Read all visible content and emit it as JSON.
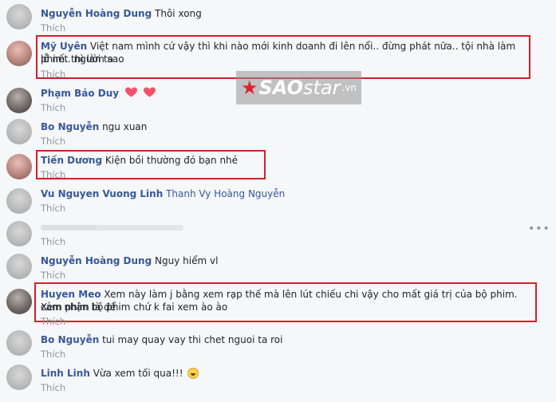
{
  "comments": [
    {
      "name": "Nguyễn Hoàng Dung",
      "text": "Thôi xong",
      "like": "Thích"
    },
    {
      "name": "Mỹ Uyên",
      "text": "Việt nam mình cứ vậy thì khi nào mới kinh doanh đi lên nổi.. đừng phát nữa.. tội nhà làm phim.. người ta",
      "text2": "lỗ nết thì làm sao",
      "like": "Thích"
    },
    {
      "name": "Phạm Bảo Duy",
      "text": "",
      "like": "Thích"
    },
    {
      "name": "Bo Nguyễn",
      "text": "ngu xuan",
      "like": "Thích"
    },
    {
      "name": "Tiến Dương",
      "text": "Kiện bồi thường đó bạn nhé",
      "like": "Thích"
    },
    {
      "name": "Vu Nguyen Vuong Linh",
      "text": "Thanh Vy Hoàng Nguyễn",
      "like": "Thích"
    },
    {
      "name": "",
      "text": "",
      "like": "Thích"
    },
    {
      "name": "Nguyễn Hoàng Dung",
      "text": "Nguy hiểm vl",
      "like": "Thích"
    },
    {
      "name": "Huyen Meo",
      "text": "Xem này làm j bằng xem rạp thế mà lên lút chiếu chi vậy cho mất giá trị của bộ phim. Xem phim là để",
      "text2": "cảm nhận bộ phim chứ k fai xem ào ào",
      "like": "Thích"
    },
    {
      "name": "Bo Nguyễn",
      "text": "tui may quay vay thi chet nguoi ta roi",
      "like": "Thích"
    },
    {
      "name": "Linh Linh",
      "text": "Vừa xem tối qua!!!",
      "like": "Thích"
    }
  ],
  "watermark": {
    "brand_main": "SAO",
    "brand_second": "star",
    "brand_tld": ".vn"
  },
  "icons": {
    "hearts": "heart-icon",
    "emoji": "laughing-emoji-icon",
    "more": "more-options-icon"
  },
  "colors": {
    "name": "#365899",
    "like": "#90949c",
    "highlight": "#d0202a",
    "background": "#f6f7f9"
  }
}
